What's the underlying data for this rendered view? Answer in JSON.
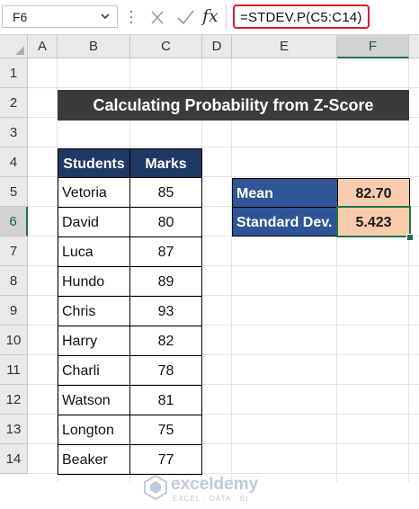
{
  "formula_bar": {
    "name_box": "F6",
    "cancel_icon": "cancel-icon",
    "enter_icon": "check-icon",
    "function_icon": "fx",
    "formula": "=STDEV.P(C5:C14)"
  },
  "columns": [
    "A",
    "B",
    "C",
    "D",
    "E",
    "F"
  ],
  "rows": [
    "1",
    "2",
    "3",
    "4",
    "5",
    "6",
    "7",
    "8",
    "9",
    "10",
    "11",
    "12",
    "13",
    "14"
  ],
  "selected_cell": "F6",
  "title": "Calculating Probability from Z-Score",
  "table": {
    "headers": [
      "Students",
      "Marks"
    ],
    "rows": [
      [
        "Vetoria",
        "85"
      ],
      [
        "David",
        "80"
      ],
      [
        "Luca",
        "87"
      ],
      [
        "Hundo",
        "89"
      ],
      [
        "Chris",
        "93"
      ],
      [
        "Harry",
        "82"
      ],
      [
        "Charli",
        "78"
      ],
      [
        "Watson",
        "81"
      ],
      [
        "Longton",
        "75"
      ],
      [
        "Beaker",
        "77"
      ]
    ]
  },
  "summary": [
    {
      "label": "Mean",
      "value": "82.70"
    },
    {
      "label": "Standard Dev.",
      "value": "5.423"
    }
  ],
  "watermark": {
    "name": "exceldemy",
    "tagline": "EXCEL · DATA · BI"
  },
  "colors": {
    "accent": "#217346",
    "header_dark": "#203864",
    "label_blue": "#2f5597",
    "value_peach": "#f8cbad",
    "title_bg": "#3b3b3b"
  }
}
